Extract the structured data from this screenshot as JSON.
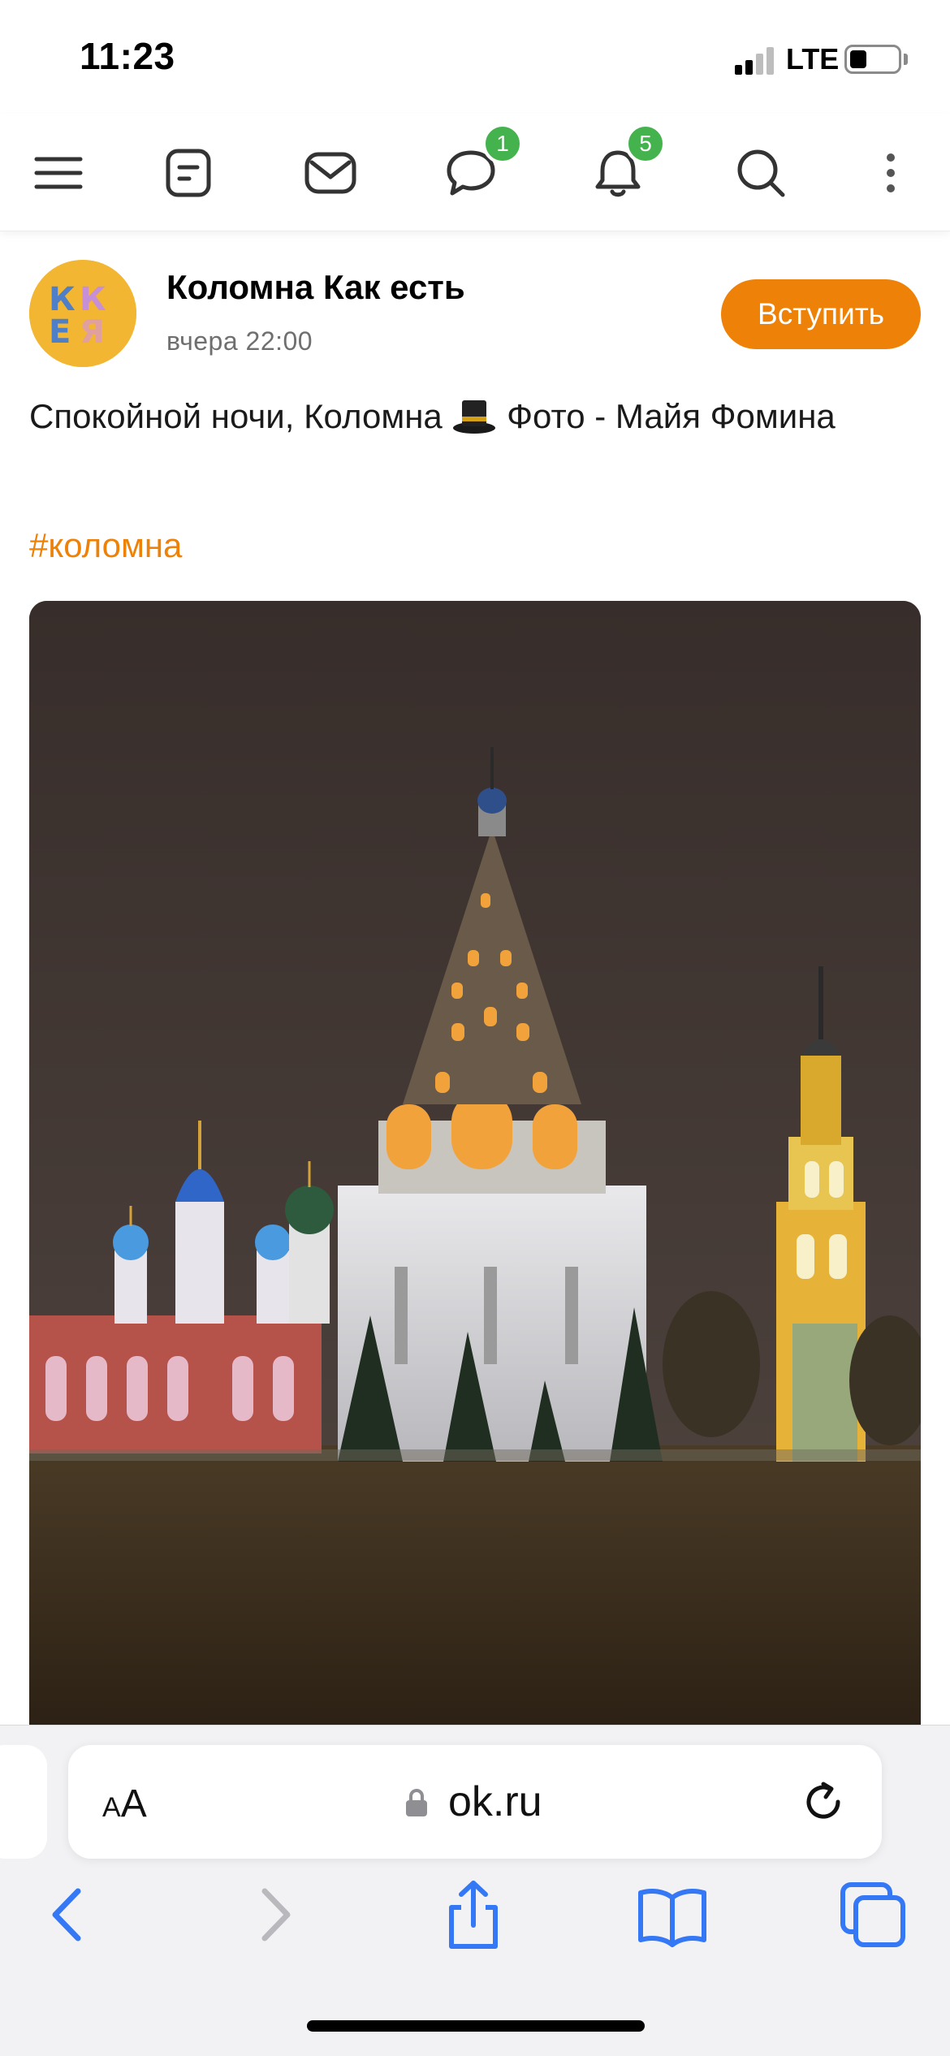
{
  "status_bar": {
    "time": "11:23",
    "network": "LTE"
  },
  "nav": {
    "chat_badge": "1",
    "notifications_badge": "5",
    "icons": [
      "menu-icon",
      "feed-icon",
      "mail-icon",
      "chat-icon",
      "bell-icon",
      "search-icon",
      "more-icon"
    ]
  },
  "post": {
    "group_name": "Коломна Как есть",
    "time": "вчера 22:00",
    "join_label": "Вступить",
    "text_before_emoji": "Спокойной ночи, Коломна ",
    "text_after_emoji": " Фото - Майя Фомина",
    "hashtag": "#коломна",
    "photo_icon": "photo-kremlin-church"
  },
  "browser": {
    "text_size_label_small": "A",
    "text_size_label_large": "A",
    "url": "ok.ru"
  },
  "colors": {
    "accent": "#ee8208",
    "badge": "#44b34d",
    "safari_blue": "#3478f6"
  }
}
